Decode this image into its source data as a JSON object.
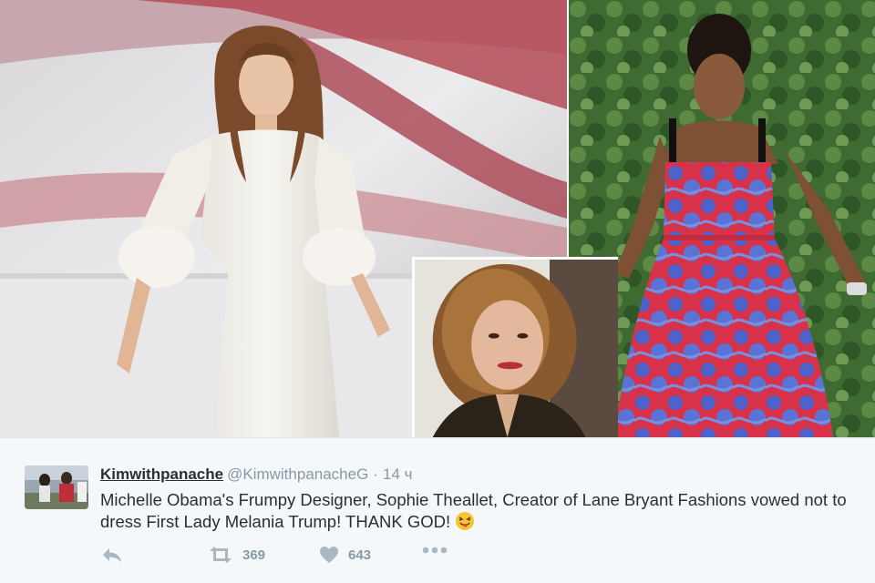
{
  "collage": {
    "photos": [
      "left-photo",
      "right-photo",
      "inset-portrait"
    ]
  },
  "tweet": {
    "display_name": "Kimwithpanache",
    "handle": "@KimwithpanacheG",
    "separator": "·",
    "time": "14 ч",
    "text": "Michelle Obama's Frumpy Designer, Sophie Theallet, Creator of Lane Bryant Fashions vowed not to dress First Lady Melania Trump! THANK GOD!",
    "emoji": "face-with-tongue",
    "actions": {
      "reply_icon": "reply-icon",
      "retweet_icon": "retweet-icon",
      "retweet_count": "369",
      "like_icon": "heart-icon",
      "like_count": "643",
      "more_icon": "more-dots-icon"
    }
  },
  "colors": {
    "tweet_bg": "#f5f8fa",
    "text": "#292f33",
    "muted": "#8899a6",
    "icon": "#aab8c2"
  }
}
